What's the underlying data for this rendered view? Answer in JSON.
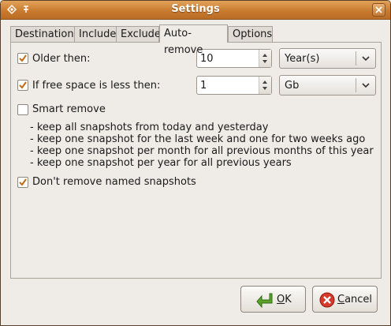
{
  "window": {
    "title": "Settings"
  },
  "tabs": [
    {
      "label": "Destination"
    },
    {
      "label": "Include"
    },
    {
      "label": "Exclude"
    },
    {
      "label": "Auto-remove"
    },
    {
      "label": "Options"
    }
  ],
  "active_tab": "Auto-remove",
  "auto_remove": {
    "older_than": {
      "label": "Older then:",
      "checked": true,
      "value": "10",
      "unit": "Year(s)"
    },
    "free_space": {
      "label": "If free space is less then:",
      "checked": true,
      "value": "1",
      "unit": "Gb"
    },
    "smart_remove": {
      "label": "Smart remove",
      "checked": false,
      "rules": [
        "- keep all snapshots from today and yesterday",
        "- keep one snapshot for the last week and one for two weeks ago",
        "- keep one snapshot per month for all previous months of this year",
        "- keep one snapshot per year for all previous years"
      ]
    },
    "dont_remove_named": {
      "label": "Don't remove named snapshots",
      "checked": true
    }
  },
  "buttons": {
    "ok": {
      "prefix": "",
      "mnemonic": "O",
      "rest": "K",
      "icon": "ok-arrow-icon"
    },
    "cancel": {
      "prefix": "",
      "mnemonic": "C",
      "rest": "ancel",
      "icon": "cancel-icon"
    }
  },
  "colors": {
    "titlebar": "#c97b2f",
    "check": "#c46a12",
    "window_bg": "#efebe7"
  }
}
